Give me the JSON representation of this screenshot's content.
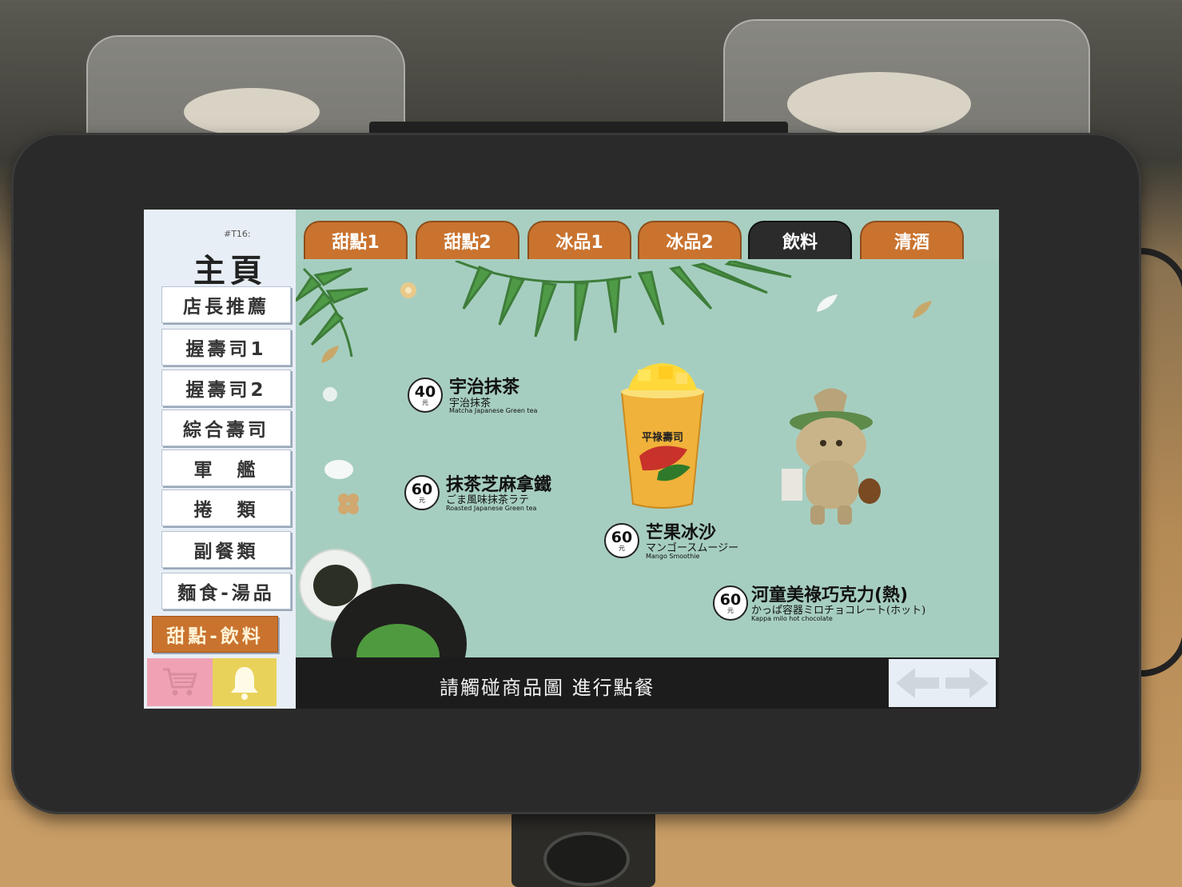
{
  "device": {
    "table_number": "#T16:",
    "home_title": "主頁"
  },
  "sidebar": {
    "items": [
      {
        "label": "店長推薦",
        "active": false
      },
      {
        "label": "握壽司1",
        "active": false
      },
      {
        "label": "握壽司2",
        "active": false
      },
      {
        "label": "綜合壽司",
        "active": false
      },
      {
        "label": "軍　艦",
        "active": false
      },
      {
        "label": "捲　類",
        "active": false
      },
      {
        "label": "副餐類",
        "active": false
      },
      {
        "label": "麵食-湯品",
        "active": false
      },
      {
        "label": "甜點-飲料",
        "active": true
      }
    ],
    "cart_icon": "shopping-cart-icon",
    "bell_icon": "bell-icon"
  },
  "tabs": [
    {
      "label": "甜點1",
      "active": false
    },
    {
      "label": "甜點2",
      "active": false
    },
    {
      "label": "冰品1",
      "active": false
    },
    {
      "label": "冰品2",
      "active": false
    },
    {
      "label": "飲料",
      "active": true
    },
    {
      "label": "清酒",
      "active": false
    }
  ],
  "menu_items": [
    {
      "price": "40",
      "unit": "元",
      "name": "宇治抹茶",
      "name_jp": "宇治抹茶",
      "name_en": "Matcha Japanese Green tea"
    },
    {
      "price": "60",
      "unit": "元",
      "name": "抹茶芝麻拿鐵",
      "name_jp": "ごま風味抹茶ラテ",
      "name_en": "Roasted Japanese Green tea"
    },
    {
      "price": "60",
      "unit": "元",
      "name": "芒果冰沙",
      "name_jp": "マンゴースムージー",
      "name_en": "Mango Smoothie"
    },
    {
      "price": "60",
      "unit": "元",
      "name": "河童美祿巧克力(熱)",
      "name_jp": "かっぱ容器ミロチョコレート(ホット)",
      "name_en": "Kappa milo hot chocolate"
    }
  ],
  "cup_brand": "平祿壽司",
  "bottom": {
    "prompt": "請觸碰商品圖 進行點餐",
    "nav_icon": "left-right-arrows-icon"
  },
  "colors": {
    "tab_orange": "#c9732f",
    "tab_active": "#2b2b2b",
    "menu_bg": "#a6cec0"
  }
}
